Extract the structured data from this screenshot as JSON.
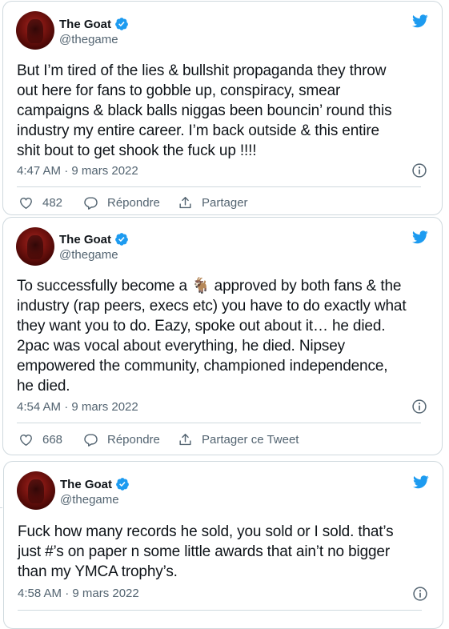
{
  "tweets": [
    {
      "author": "The Goat",
      "handle": "@thegame",
      "text": "But I’m tired of the lies & bullshit propaganda they throw\nout here for fans to gobble up, conspiracy, smear\ncampaigns & black balls niggas been bouncin’ round this\nindustry my entire career. I’m back outside & this entire\nshit bout to get shook the fuck up !!!!",
      "timestamp": "4:47 AM · 9 mars 2022",
      "likes": "482",
      "reply_label": "Répondre",
      "share_label": "Partager"
    },
    {
      "author": "The Goat",
      "handle": "@thegame",
      "text_before_emoji": "To successfully become a ",
      "text_after_emoji": " approved by both fans & the\nindustry (rap peers, execs etc) you have to do exactly what\nthey want you to do. Eazy, spoke out about it… he died.\n2pac was vocal about everything, he died. Nipsey\nempowered the community, championed independence,\nhe died.",
      "emoji": "🐐",
      "timestamp": "4:54 AM · 9 mars 2022",
      "likes": "668",
      "reply_label": "Répondre",
      "share_label": "Partager ce Tweet"
    },
    {
      "author": "The Goat",
      "handle": "@thegame",
      "text": "Fuck how many records he sold, you sold or I sold. that’s\njust #’s on paper n some little awards that ain’t no bigger\nthan my YMCA trophy’s.",
      "timestamp": "4:58 AM · 9 mars 2022"
    }
  ],
  "colors": {
    "twitter_blue": "#1d9bf0",
    "text": "#0f1419",
    "secondary_text": "#536471",
    "border": "#cfd9de"
  },
  "icons": [
    "twitter-bird-icon",
    "verified-badge-icon",
    "info-icon",
    "heart-icon",
    "reply-icon",
    "share-icon"
  ]
}
